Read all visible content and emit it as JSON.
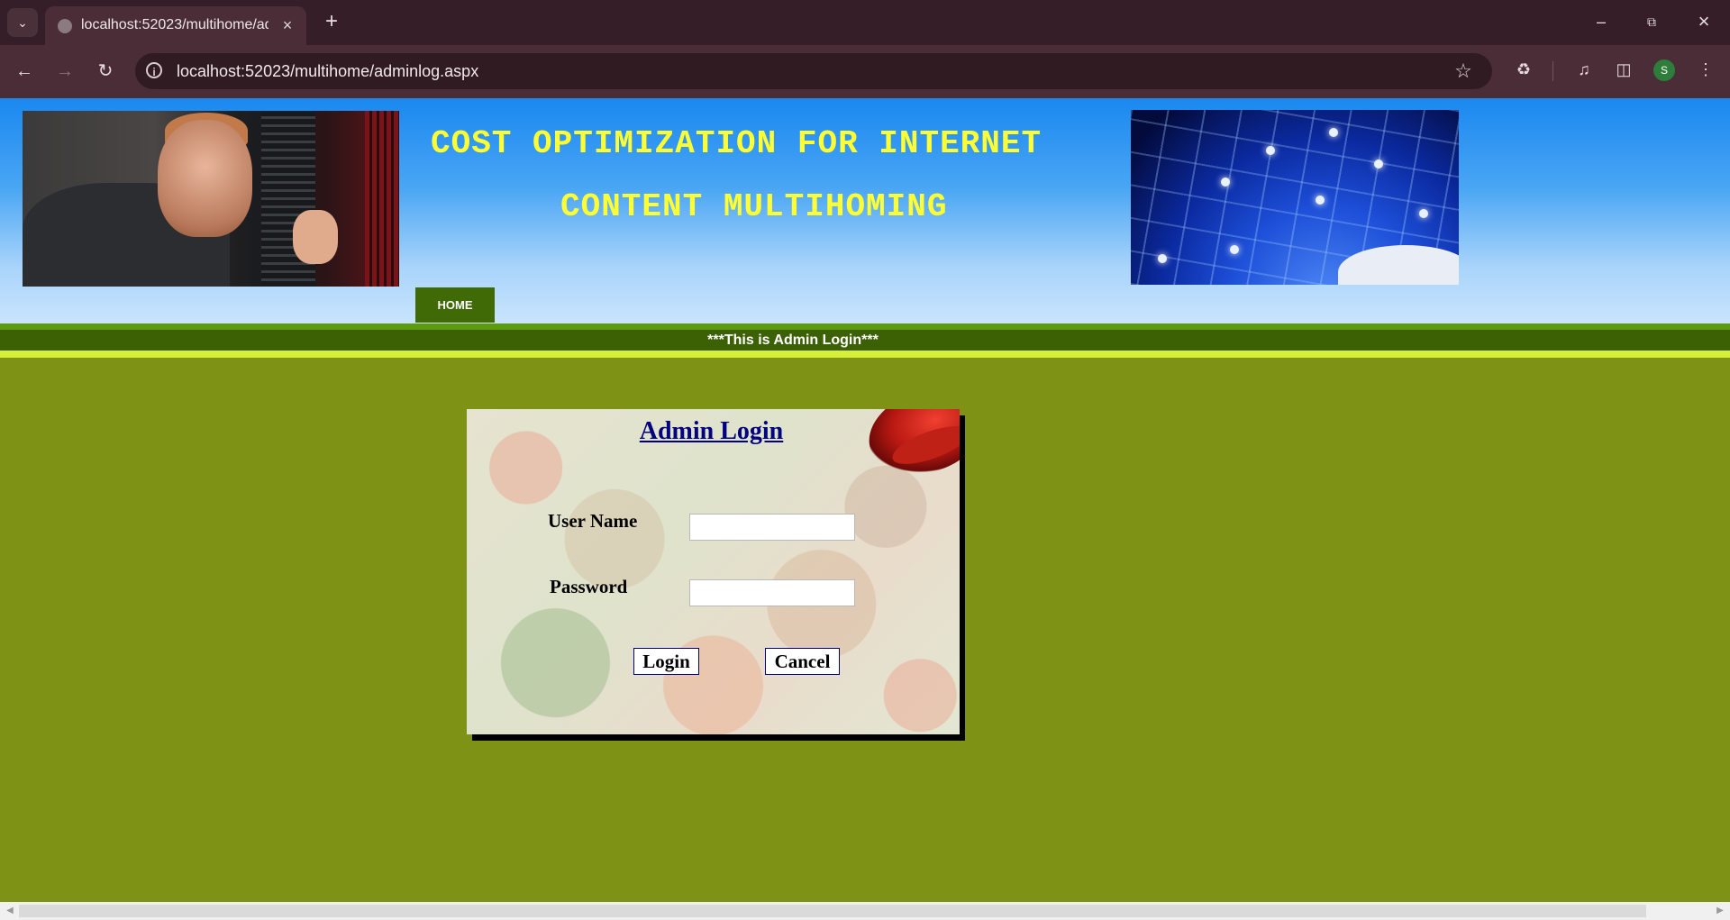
{
  "browser": {
    "tab_title": "localhost:52023/multihome/adminlog.aspx",
    "url": "localhost:52023/multihome/adminlog.aspx",
    "profile_initial": "S",
    "icons": {
      "tab_menu": "chevron-down-icon",
      "favicon": "globe-icon",
      "close_tab": "close-icon",
      "new_tab": "plus-icon",
      "minimize": "minimize-icon",
      "restore": "restore-icon",
      "close_window": "close-icon",
      "back": "arrow-left-icon",
      "forward": "arrow-right-icon",
      "reload": "reload-icon",
      "site_info": "info-icon",
      "bookmark": "star-icon",
      "extensions": "puzzle-icon",
      "media": "media-icon",
      "side_panel": "side-panel-icon",
      "menu": "more-vert-icon"
    }
  },
  "header": {
    "title_line1": "COST OPTIMIZATION FOR INTERNET",
    "title_line2": "CONTENT MULTIHOMING",
    "nav_home": "HOME",
    "colors": {
      "title": "#ffff33",
      "nav_bg": "#3f6a05"
    }
  },
  "banner": {
    "text": "***This is Admin Login***"
  },
  "login": {
    "title": "Admin Login",
    "username_label": "User Name",
    "password_label": "Password",
    "username_value": "",
    "password_value": "",
    "login_button": "Login",
    "cancel_button": "Cancel"
  },
  "colors": {
    "page_bg": "#7e9216",
    "band_dark": "#3c6105",
    "band_light": "#d6f03a",
    "login_title": "#000080"
  }
}
